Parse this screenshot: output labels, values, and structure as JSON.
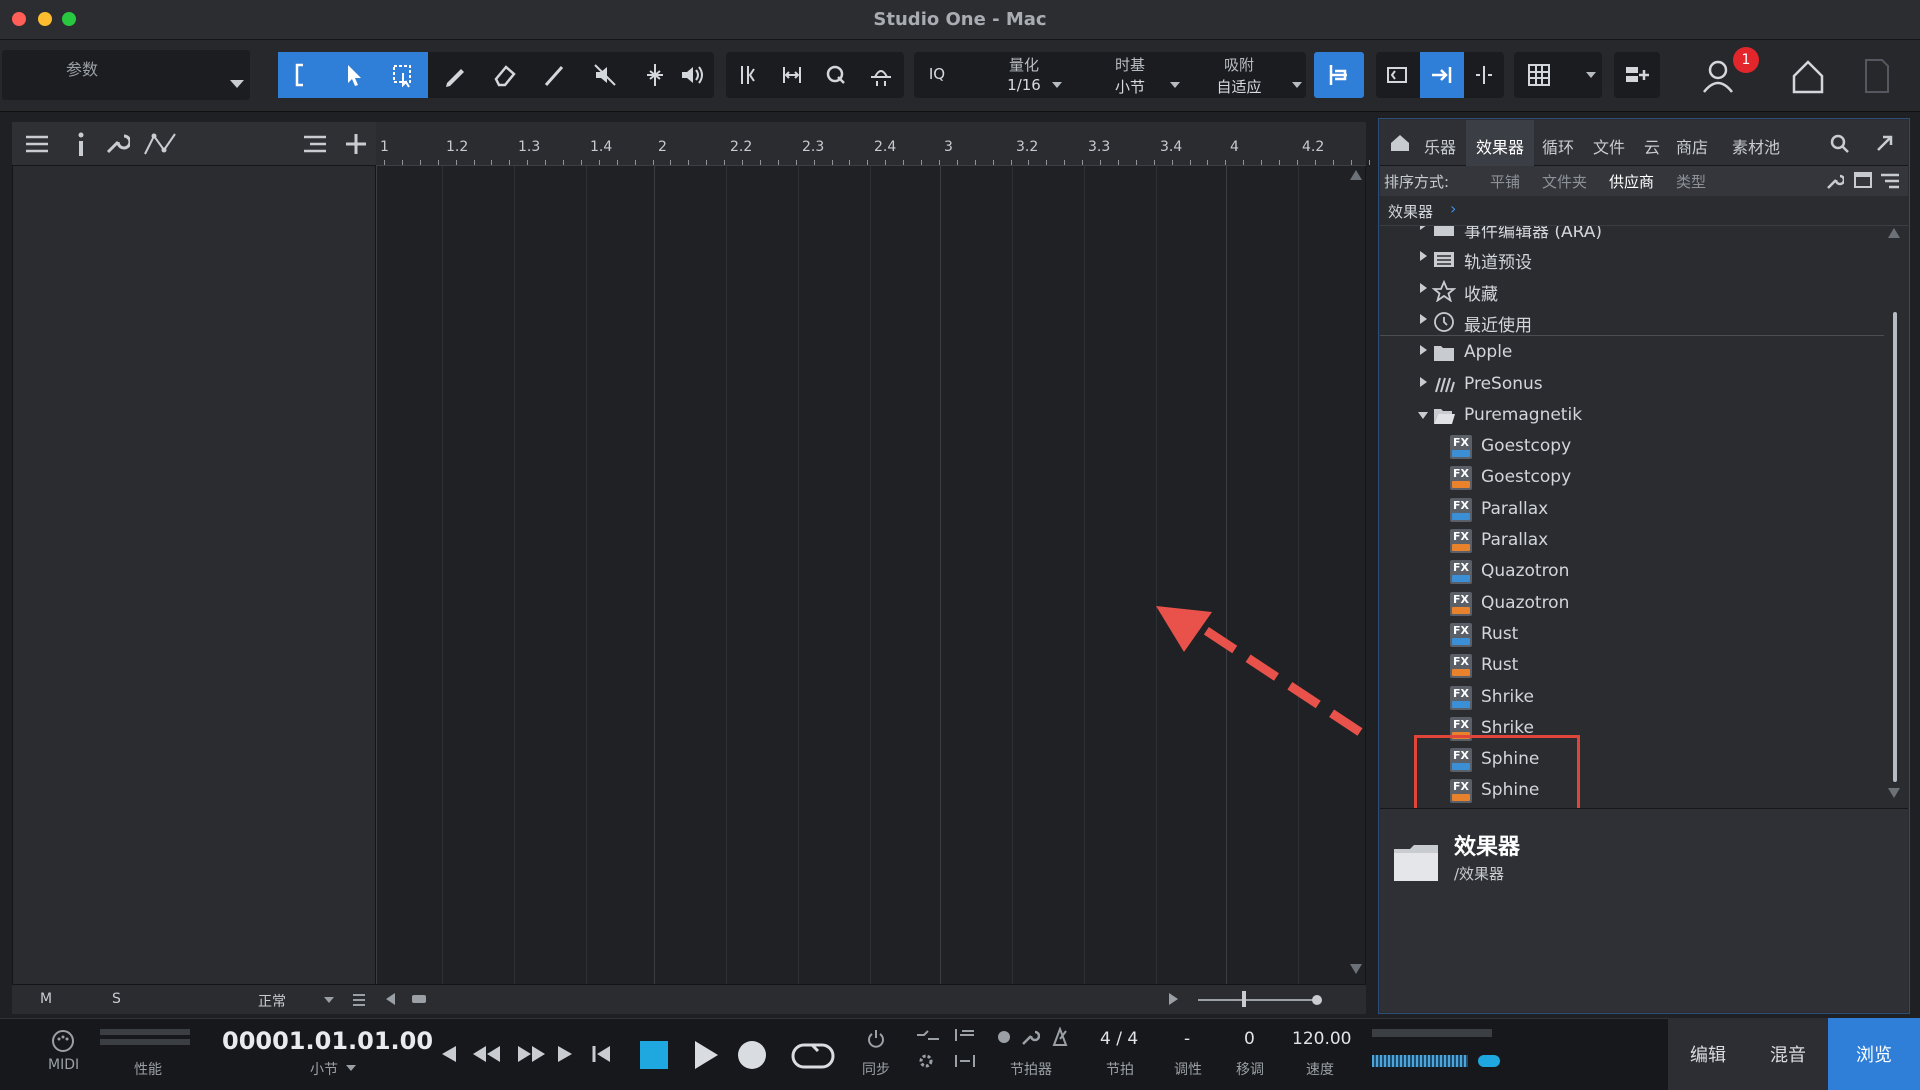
{
  "window": {
    "title": "Studio One - Mac"
  },
  "toolbar": {
    "params_label": "参数",
    "iq_label": "IQ",
    "quantize_label": "量化",
    "quantize_value": "1/16",
    "timebase_label": "时基",
    "timebase_value": "小节",
    "snap_label": "吸附",
    "snap_value": "自适应",
    "notification_count": "1"
  },
  "ruler": {
    "ticks": [
      "1",
      "1.2",
      "1.3",
      "1.4",
      "2",
      "2.2",
      "2.3",
      "2.4",
      "3",
      "3.2",
      "3.3",
      "3.4",
      "4",
      "4.2"
    ]
  },
  "track_footer": {
    "m": "M",
    "s": "S",
    "mode": "正常"
  },
  "browser": {
    "tabs": [
      "乐器",
      "效果器",
      "循环",
      "文件",
      "云",
      "商店",
      "素材池"
    ],
    "active_tab": "效果器",
    "sort_label": "排序方式:",
    "sort_options": [
      "平铺",
      "文件夹",
      "供应商",
      "类型"
    ],
    "active_sort": "供应商",
    "breadcrumb": "效果器",
    "tree": [
      {
        "label": "事件编辑器 (ARA)",
        "type": "folder"
      },
      {
        "label": "轨道预设",
        "type": "preset"
      },
      {
        "label": "收藏",
        "type": "star"
      },
      {
        "label": "最近使用",
        "type": "clock"
      },
      {
        "label": "Apple",
        "type": "folder"
      },
      {
        "label": "PreSonus",
        "type": "presonus"
      },
      {
        "label": "Puremagnetik",
        "type": "folder-open"
      },
      {
        "label": "Goestcopy",
        "type": "vst3"
      },
      {
        "label": "Goestcopy",
        "type": "au"
      },
      {
        "label": "Parallax",
        "type": "vst3"
      },
      {
        "label": "Parallax",
        "type": "au"
      },
      {
        "label": "Quazotron",
        "type": "vst3"
      },
      {
        "label": "Quazotron",
        "type": "au"
      },
      {
        "label": "Rust",
        "type": "vst3"
      },
      {
        "label": "Rust",
        "type": "au"
      },
      {
        "label": "Shrike",
        "type": "vst3"
      },
      {
        "label": "Shrike",
        "type": "au"
      },
      {
        "label": "Sphine",
        "type": "vst3"
      },
      {
        "label": "Sphine",
        "type": "au"
      }
    ],
    "info_title": "效果器",
    "info_path": "/效果器"
  },
  "transport": {
    "midi_label": "MIDI",
    "perf_label": "性能",
    "position": "00001.01.01.00",
    "position_unit": "小节",
    "sync_label": "同步",
    "metronome_label": "节拍器",
    "time_signature": "4 / 4",
    "time_signature_label": "节拍",
    "key": "-",
    "key_label": "调性",
    "transpose": "0",
    "transpose_label": "移调",
    "tempo": "120.00",
    "tempo_label": "速度"
  },
  "modes": {
    "edit": "编辑",
    "mix": "混音",
    "browse": "浏览"
  },
  "colors": {
    "accent": "#2f7fd8",
    "highlight_box": "#e0453a",
    "arrow": "#e8524a"
  }
}
